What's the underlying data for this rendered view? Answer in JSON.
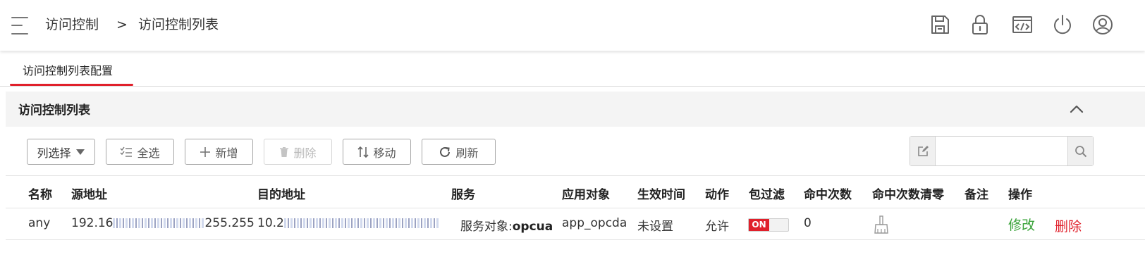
{
  "header": {
    "breadcrumb_root": "访问控制",
    "breadcrumb_sep": ">",
    "breadcrumb_current": "访问控制列表"
  },
  "tabs": [
    {
      "label": "访问控制列表配置",
      "active": true
    }
  ],
  "panel": {
    "title": "访问控制列表"
  },
  "toolbar": {
    "column_select": "列选择",
    "select_all": "全选",
    "add": "新增",
    "delete": "删除",
    "move": "移动",
    "refresh": "刷新"
  },
  "search": {
    "placeholder": ""
  },
  "table": {
    "headers": {
      "name": "名称",
      "source": "源地址",
      "dest": "目的地址",
      "service": "服务",
      "app": "应用对象",
      "time": "生效时间",
      "action": "动作",
      "filter": "包过滤",
      "hits": "命中次数",
      "clear_hits": "命中次数清零",
      "remark": "备注",
      "operation": "操作"
    },
    "rows": [
      {
        "name": "any",
        "source_prefix": "192.16",
        "source_suffix": "255.255",
        "dest_prefix": "10.2",
        "dest_suffix": "",
        "service_label": "服务对象:",
        "service_value": "opcua",
        "app": "app_opcda",
        "time": "未设置",
        "action": "允许",
        "filter_state": "ON",
        "hits": "0",
        "remark": "",
        "edit": "修改",
        "delete": "删除"
      }
    ]
  },
  "colors": {
    "accent": "#e0202b",
    "edit_link": "#3aa33a"
  },
  "icons": {
    "header": [
      "save-icon",
      "lock-icon",
      "code-window-icon",
      "power-icon",
      "user-icon"
    ],
    "collapse": "chevron-up-icon",
    "clear_hits": "broom-icon"
  }
}
